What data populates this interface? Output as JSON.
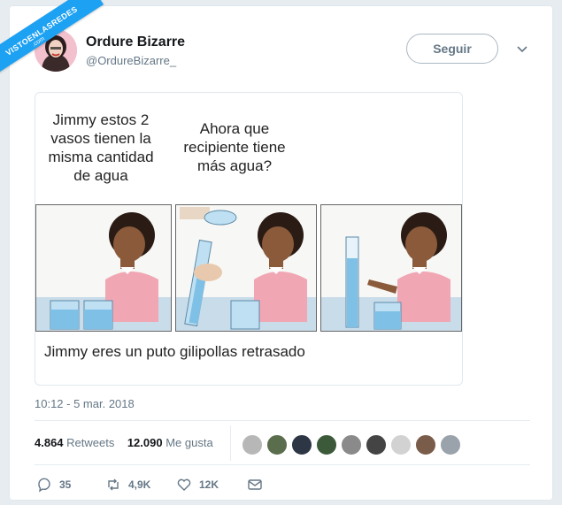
{
  "watermark": {
    "text": "VISTOENLASREDES",
    "sub": ".com"
  },
  "tweet": {
    "author_name": "Ordure Bizarre",
    "author_handle": "@OrdureBizarre_",
    "follow_label": "Seguir",
    "timestamp": "10:12 - 5 mar. 2018",
    "retweets_count": "4.864",
    "retweets_label": "Retweets",
    "likes_count": "12.090",
    "likes_label": "Me gusta",
    "reply_count": "35",
    "retweet_count_short": "4,9K",
    "like_count_short": "12K"
  },
  "comic": {
    "caption_1": "Jimmy estos 2 vasos tienen la misma cantidad de agua",
    "caption_2": "Ahora que recipiente tiene más agua?",
    "caption_3": "Jimmy eres un puto gilipollas retrasado"
  },
  "colors": {
    "accent": "#1da1f2",
    "muted": "#657786",
    "text": "#14171a"
  },
  "icons": [
    "reply-icon",
    "retweet-icon",
    "like-icon",
    "message-icon",
    "chevron-down-icon"
  ]
}
